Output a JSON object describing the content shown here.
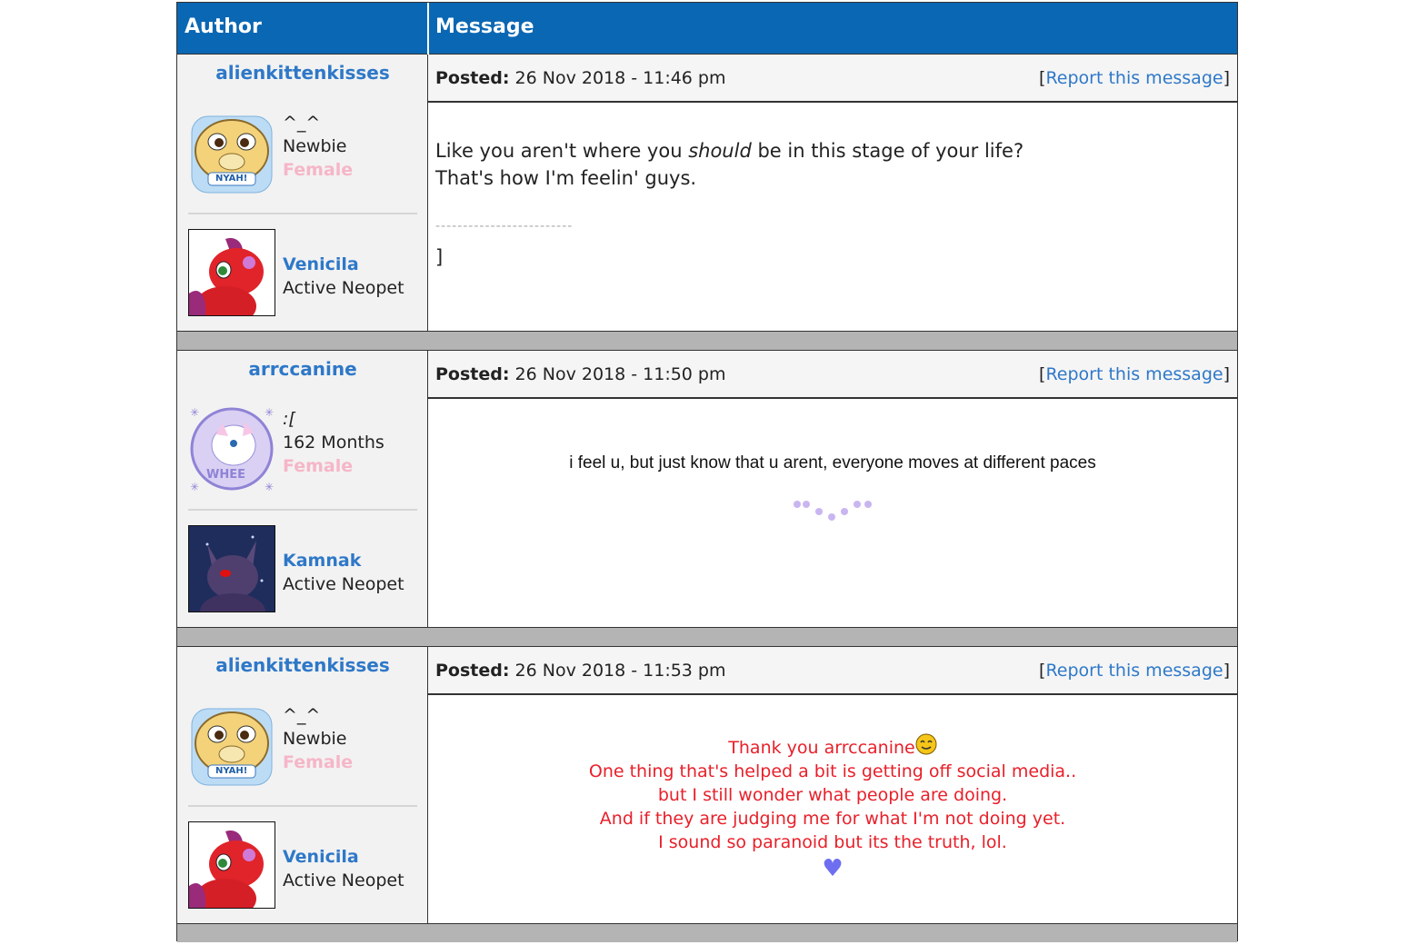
{
  "header": {
    "author_label": "Author",
    "message_label": "Message"
  },
  "posts": [
    {
      "username": "alienkittenkisses",
      "mood": "^_^",
      "rank": "Newbie",
      "gender": "Female",
      "avatar_icon": "tan-cat-nyah-avatar-icon",
      "avatar_text": "NYAH!",
      "pet_name": "Venicila",
      "pet_status": "Active Neopet",
      "posted_label": "Posted:",
      "posted_time": "26 Nov 2018 - 11:46 pm",
      "report_label": "Report this message",
      "message_lines": [
        "Like you aren't where you ",
        "should",
        " be in this stage of your life?",
        "That's how I'm feelin' guys."
      ],
      "signature_dashes": "-------------------------",
      "signature_bracket": "]"
    },
    {
      "username": "arrccanine",
      "mood": ":[",
      "rank": "162 Months",
      "gender": "Female",
      "avatar_icon": "white-dog-whee-avatar-icon",
      "avatar_text": "WHEE",
      "pet_name": "Kamnak",
      "pet_status": "Active Neopet",
      "posted_label": "Posted:",
      "posted_time": "26 Nov 2018 - 11:50 pm",
      "report_label": "Report this message",
      "message_text": "i feel u, but just know that u arent, everyone moves at different paces"
    },
    {
      "username": "alienkittenkisses",
      "mood": "^_^",
      "rank": "Newbie",
      "gender": "Female",
      "avatar_icon": "tan-cat-nyah-avatar-icon",
      "avatar_text": "NYAH!",
      "pet_name": "Venicila",
      "pet_status": "Active Neopet",
      "posted_label": "Posted:",
      "posted_time": "26 Nov 2018 - 11:53 pm",
      "report_label": "Report this message",
      "message_lines": [
        "Thank you arrccanine",
        "One thing that's helped a bit is getting off social media..",
        "but I still wonder what people are doing.",
        "And if they are judging me for what I'm not doing yet.",
        "I sound so paranoid but its the truth, lol."
      ],
      "heart": "♥"
    }
  ],
  "colors": {
    "header_bg": "#0a67b3",
    "username": "#2e78c8",
    "gender": "#f6b6c8",
    "red_text": "#e8202a",
    "spacer": "#b4b4b4"
  }
}
